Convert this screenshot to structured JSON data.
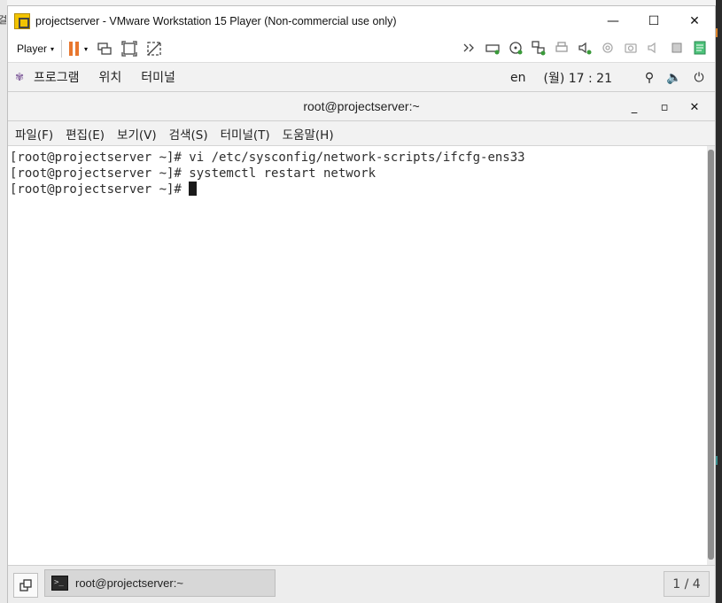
{
  "host": {
    "left_fragment": "걸"
  },
  "window": {
    "title": "projectserver - VMware Workstation 15 Player (Non-commercial use only)",
    "minimize": "—",
    "maximize": "☐",
    "close": "✕"
  },
  "toolbar": {
    "player_label": "Player",
    "player_caret": "▾",
    "pause_caret": "▾",
    "send_keys_icon": "send-ctrl-alt-del-icon",
    "fit_icon": "fit-guest-icon",
    "unity_icon": "unity-icon",
    "right_icons": [
      "forward-icon",
      "hdd-icon",
      "cd-icon",
      "network-icon",
      "printer-icon",
      "sound-icon",
      "camera-icon",
      "webcam-icon",
      "speaker-icon",
      "usb-device-icon",
      "message-icon"
    ]
  },
  "gnome": {
    "applications": "프로그램",
    "places": "위치",
    "terminal": "터미널",
    "lang": "en",
    "clock": "(월) 17 : 21",
    "network_icon": "network-icon",
    "volume_icon": "volume-icon",
    "power_icon": "power-icon"
  },
  "terminal": {
    "title": "root@projectserver:~",
    "minimize": "_",
    "maximize": "▫",
    "close": "✕",
    "menu": [
      "파일(F)",
      "편집(E)",
      "보기(V)",
      "검색(S)",
      "터미널(T)",
      "도움말(H)"
    ],
    "lines": [
      "[root@projectserver ~]# vi /etc/sysconfig/network-scripts/ifcfg-ens33",
      "[root@projectserver ~]# systemctl restart network",
      "[root@projectserver ~]# "
    ]
  },
  "taskbar": {
    "task_label": "root@projectserver:~",
    "task_icon_glyph": ">_",
    "pager": "1 / 4"
  }
}
